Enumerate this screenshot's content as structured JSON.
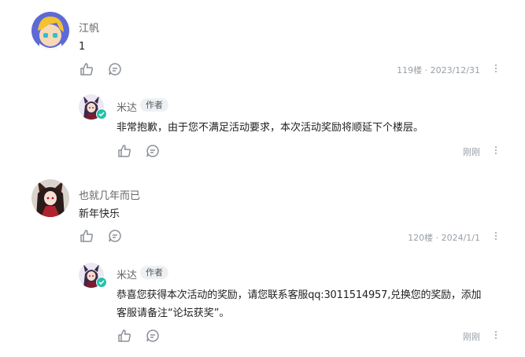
{
  "comments": [
    {
      "username": "江帆",
      "content": "1",
      "floor": "119楼",
      "date": "2023/12/31",
      "reply": {
        "username": "米达",
        "badge": "作者",
        "content": "非常抱歉，由于您不满足活动要求，本次活动奖励将顺延下个楼层。",
        "time": "刚刚"
      }
    },
    {
      "username": "也就几年而已",
      "content": "新年快乐",
      "floor": "120楼",
      "date": "2024/1/1",
      "reply": {
        "username": "米达",
        "badge": "作者",
        "content_line1": "恭喜您获得本次活动的奖励，请您联系客服qq:3011514957,兑换您的奖励，添加",
        "content_line2": "客服请备注“论坛获奖”。",
        "time": "刚刚"
      }
    }
  ],
  "separator": "·",
  "icons": {
    "like": "thumbs-up-icon",
    "reply": "comment-bubble-icon",
    "more": "more-vertical-icon",
    "verified": "verified-check-icon"
  },
  "colors": {
    "text_primary": "#222222",
    "text_secondary": "#666666",
    "meta": "#9aa0a6",
    "verified": "#22c1a8"
  }
}
